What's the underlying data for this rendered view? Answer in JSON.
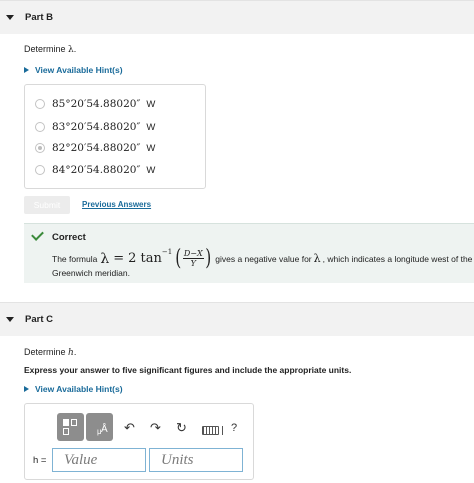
{
  "partB": {
    "title": "Part B",
    "prompt_prefix": "Determine ",
    "prompt_symbol": "λ",
    "prompt_suffix": ".",
    "hint_label": "View Available Hint(s)",
    "options": [
      {
        "value": "85°20′54.88020″",
        "dir": "W",
        "selected": false
      },
      {
        "value": "83°20′54.88020″",
        "dir": "W",
        "selected": false
      },
      {
        "value": "82°20′54.88020″",
        "dir": "W",
        "selected": true
      },
      {
        "value": "84°20′54.88020″",
        "dir": "W",
        "selected": false
      }
    ],
    "submit_label": "Submit",
    "previous_answers_label": "Previous Answers",
    "feedback": {
      "title": "Correct",
      "text_prefix": "The formula",
      "formula_lambda": "λ",
      "formula_eq": "=",
      "formula_fn": "2 tan",
      "formula_exp": "−1",
      "formula_num": "D−X",
      "formula_den": "Y",
      "text_middle": "gives a negative value for",
      "text_lambda": "λ",
      "text_suffix": ", which indicates a longitude west of the",
      "text_line2": "Greenwich meridian."
    }
  },
  "partC": {
    "title": "Part C",
    "prompt_prefix": "Determine ",
    "prompt_symbol": "h",
    "prompt_suffix": ".",
    "instruction": "Express your answer to five significant figures and include the appropriate units.",
    "hint_label": "View Available Hint(s)",
    "toolbar": {
      "template_unit_label": "μ",
      "template_angstrom_label": "Å",
      "undo_icon": "↶",
      "redo_icon": "↷",
      "reset_icon": "↻",
      "help_label": "?"
    },
    "answer_label": "h =",
    "value_placeholder": "Value",
    "units_placeholder": "Units"
  }
}
